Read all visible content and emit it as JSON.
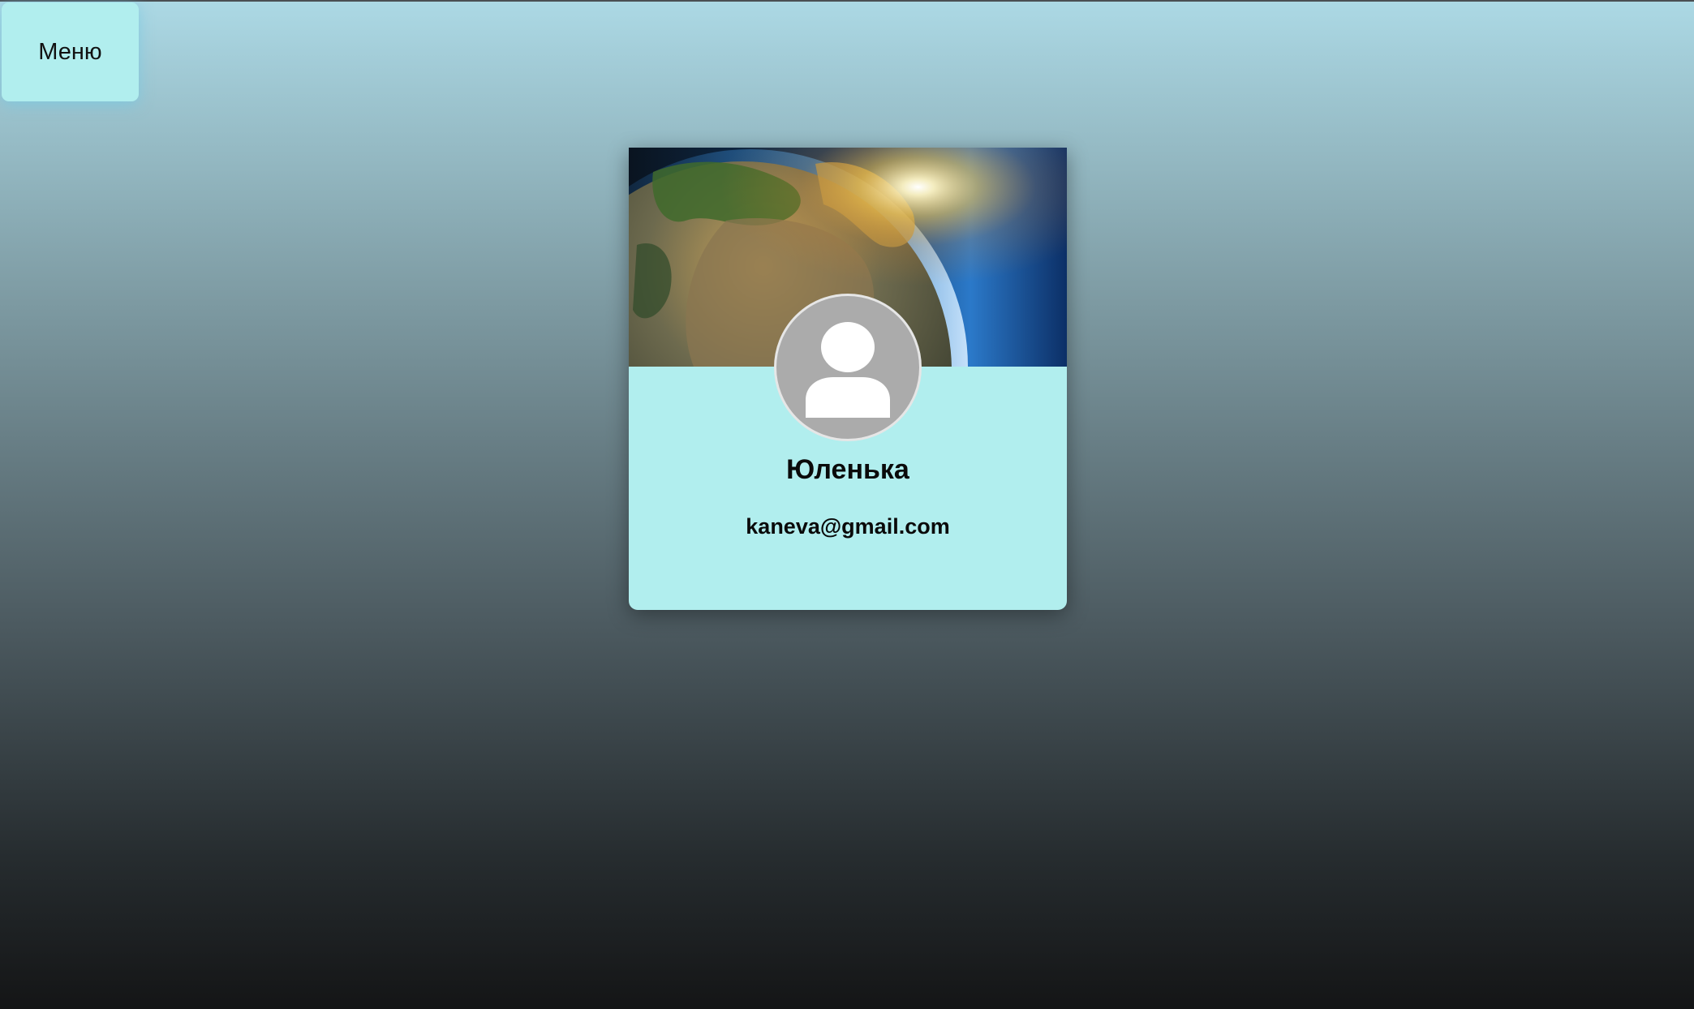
{
  "menu": {
    "label": "Меню"
  },
  "profile": {
    "name": "Юленька",
    "email": "kaneva@gmail.com",
    "avatar_icon": "user-silhouette-icon",
    "cover_image": "earth-from-space-image"
  },
  "colors": {
    "card_background": "#b1eeee",
    "menu_background": "#b1eeee",
    "avatar_background": "#ababab"
  }
}
